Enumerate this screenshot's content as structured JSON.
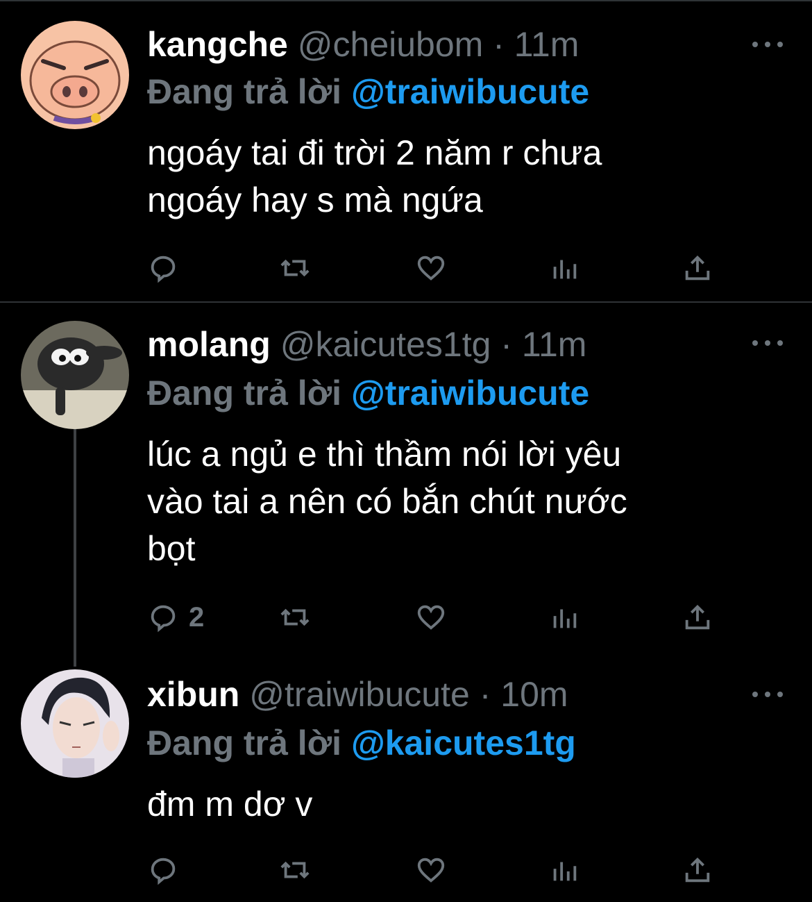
{
  "tweets": [
    {
      "display_name": "kangche",
      "handle": "@cheiubom",
      "separator": "·",
      "time": "11m",
      "replying_prefix": "Đang trả lời",
      "replying_to": "@traiwibucute",
      "text_lines": [
        "ngoáy tai đi trời 2 năm r chưa",
        "ngoáy hay s mà ngứa"
      ],
      "reply_count": "",
      "avatar": "pig-cartoon-avatar"
    },
    {
      "display_name": "molang",
      "handle": "@kaicutes1tg",
      "separator": "·",
      "time": "11m",
      "replying_prefix": "Đang trả lời",
      "replying_to": "@traiwibucute",
      "text_lines": [
        "lúc a ngủ e thì thầm nói lời yêu",
        "vào tai a nên có bắn chút nước",
        "bọt"
      ],
      "reply_count": "2",
      "avatar": "sheep-avatar"
    },
    {
      "display_name": "xibun",
      "handle": "@traiwibucute",
      "separator": "·",
      "time": "10m",
      "replying_prefix": "Đang trả lời",
      "replying_to": "@kaicutes1tg",
      "text_lines": [
        "đm m dơ v"
      ],
      "reply_count": "",
      "avatar": "anime-boy-avatar"
    }
  ],
  "icons": [
    "reply-icon",
    "retweet-icon",
    "like-icon",
    "analytics-icon",
    "share-icon",
    "more-icon"
  ],
  "colors": {
    "background": "#000000",
    "text": "#ffffff",
    "secondary": "#6e767d",
    "accent": "#1d9bf0"
  }
}
